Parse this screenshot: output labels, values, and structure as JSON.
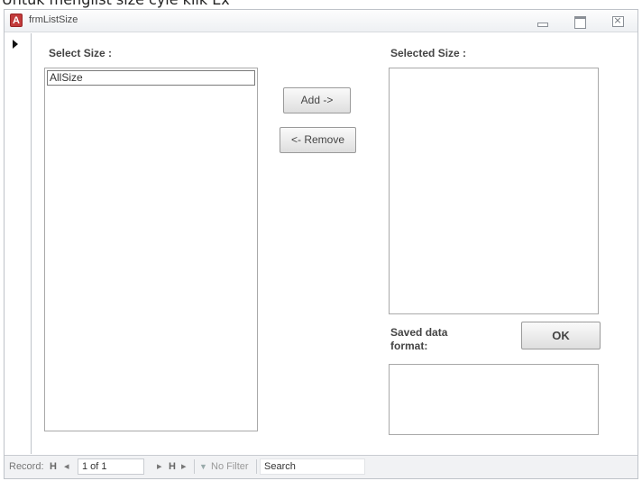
{
  "caption": "Untuk menglist size cyle klik Ex",
  "window": {
    "title": "frmListSize",
    "app_icon_letter": "A"
  },
  "form": {
    "select_size_label": "Select Size :",
    "selected_size_label": "Selected Size :",
    "saved_format_label": "Saved data format:",
    "select_list_items": [
      "AllSize"
    ],
    "add_label": "Add ->",
    "remove_label": "<- Remove",
    "ok_label": "OK"
  },
  "navigation": {
    "record_label": "Record:",
    "first_glyph": "H",
    "prev_glyph": "◂",
    "position": "1 of 1",
    "next_glyph": "▸",
    "last_glyph": "H",
    "new_glyph": "▸",
    "filter_icon_glyph": "▼",
    "filter_label": "No Filter",
    "search_label": "Search"
  }
}
